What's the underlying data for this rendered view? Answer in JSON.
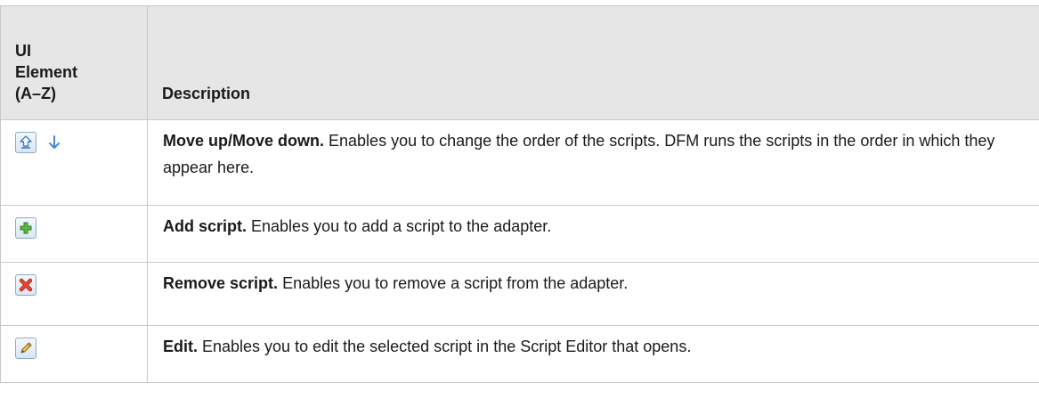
{
  "table": {
    "header": {
      "col1": [
        "UI",
        "Element",
        "(A–Z)"
      ],
      "col2": "Description"
    },
    "rows": [
      {
        "icons": [
          "move-up-icon",
          "move-down-icon"
        ],
        "title": "Move up/Move down.",
        "text": " Enables you to change the order of the scripts. DFM runs the scripts in the order in which they appear here."
      },
      {
        "icons": [
          "add-icon"
        ],
        "title": "Add script.",
        "text": " Enables you to add a script to the adapter."
      },
      {
        "icons": [
          "remove-icon"
        ],
        "title": "Remove script.",
        "text": " Enables you to remove a script from the adapter."
      },
      {
        "icons": [
          "edit-icon"
        ],
        "title": "Edit.",
        "text": " Enables you to edit the selected script in the Script Editor that opens."
      }
    ]
  },
  "colors": {
    "header_bg": "#e6e6e6",
    "border": "#c8c8c8",
    "icon_blue": "#3d7cc9",
    "add_green": "#3f9a2e",
    "remove_red": "#d8331f"
  }
}
